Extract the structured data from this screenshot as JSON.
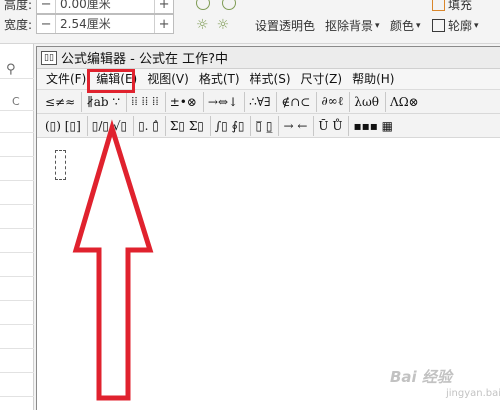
{
  "ribbon": {
    "height_label": "高度:",
    "height_value": "0.00厘米",
    "width_label": "宽度:",
    "width_value": "2.54厘米",
    "minus": "−",
    "plus": "+",
    "set_transparent": "设置透明色",
    "remove_background": "抠除背景",
    "color": "颜色",
    "outline": "轮廓",
    "fill": "填充"
  },
  "sheet": {
    "zoom_icon": "magnifier-icon",
    "column_label": "C"
  },
  "editor": {
    "title": "公式编辑器 - 公式在 工作?中",
    "menus": [
      "文件(F)",
      "编辑(E)",
      "视图(V)",
      "格式(T)",
      "样式(S)",
      "尺寸(Z)",
      "帮助(H)"
    ],
    "toolbar_row1": [
      "≤≠≈",
      "∦ab ∵",
      "⁞⁞ ⁞⁞ ⁞⁞",
      "±•⊗",
      "→⇔↓",
      "∴∀∃",
      "∉∩⊂",
      "∂∞ℓ",
      "λωθ",
      "ΛΩ⊗"
    ],
    "toolbar_row2": [
      "(▯) [▯]",
      "▯/▯ √▯",
      "▯. ▯̂",
      "Σ▯ Σ▯",
      "∫▯ ∮▯",
      "▯̅ ▯̲",
      "→ ←",
      "Ū Ů",
      "▪▪▪ ▦"
    ]
  },
  "annotation": {
    "color": "#e0222e"
  },
  "watermark": {
    "text": "Bai 经验",
    "sub": "jingyan.baidu.com"
  }
}
